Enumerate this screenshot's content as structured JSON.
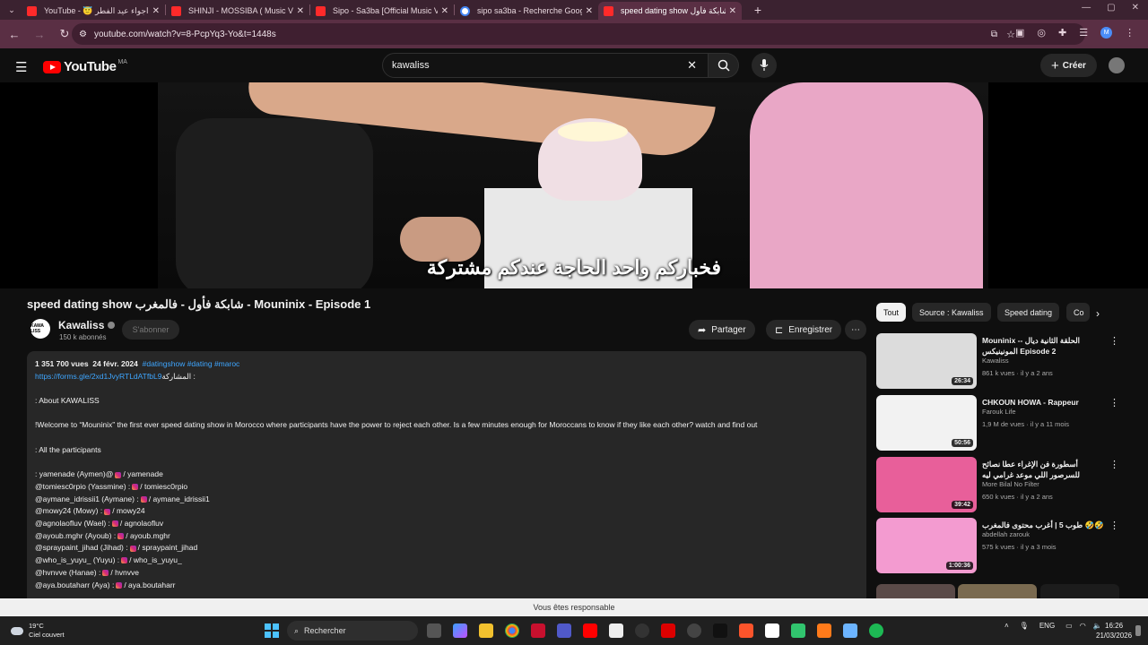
{
  "browser": {
    "tabs": [
      {
        "title": "YouTube - 😇 اجواء عيد الفطر",
        "icon": "youtube-icon",
        "active": false
      },
      {
        "title": "SHINJI - MOSSIBA ( Music Vid",
        "icon": "youtube-icon",
        "active": false
      },
      {
        "title": "Sipo - Sa3ba [Official Music Vi",
        "icon": "youtube-icon",
        "active": false
      },
      {
        "title": "sipo sa3ba - Recherche Google",
        "icon": "google-icon",
        "active": false
      },
      {
        "title": "speed dating show شابكة فأول",
        "icon": "youtube-icon",
        "active": true
      }
    ],
    "url": "youtube.com/watch?v=8-PcpYq3-Yo&t=1448s"
  },
  "youtube": {
    "logo_text": "YouTube",
    "country": "MA",
    "search_value": "kawaliss",
    "create_label": "Créer"
  },
  "video": {
    "subtitle": "فخباركم واحد الحاجة عندكم مشتركة",
    "title": "speed dating show شابكة فأول - فالمغرب - Mouninix - Episode 1",
    "channel": {
      "name": "Kawaliss",
      "subscribers": "150 k abonnés",
      "avatar_text": "KAWA LISS"
    },
    "subscribe_label": "S'abonner",
    "share_label": "Partager",
    "save_label": "Enregistrer"
  },
  "description": {
    "views": "1 351 700 vues",
    "date": "24 févr. 2024",
    "tags": "#datingshow #dating #maroc",
    "link": "https://forms.gle/2xd1JvyRTLdATfbL9",
    "link_suffix": "المشاركة :",
    "about": ": About KAWALISS",
    "welcome": "!Welcome to “Mouninix” the first ever speed dating show in Morocco where participants have the power to reject each other. Is a few minutes enough for Moroccans to know if they like each other? watch and find out",
    "participants_heading": ": All the participants",
    "participants": [
      {
        "left": " : yamenade (Aymen)@",
        "right": "/ yamenade"
      },
      {
        "left": "@tomiesc0rpio (Yassmine) :",
        "right": "/ tomiesc0rpio"
      },
      {
        "left": "@aymane_idrissii1 (Aymane) :",
        "right": "/ aymane_idrissii1"
      },
      {
        "left": "@mowy24 (Mowy) :",
        "right": "/ mowy24"
      },
      {
        "left": "@agnolaofluv (Wael) :",
        "right": "/ agnolaofluv"
      },
      {
        "left": "@ayoub.mghr (Ayoub) :",
        "right": "/ ayoub.mghr"
      },
      {
        "left": "@spraypaint_jihad (Jihad) :",
        "right": "/ spraypaint_jihad"
      },
      {
        "left": "@who_is_yuyu_ (Yuyu) :",
        "right": "/ who_is_yuyu_"
      },
      {
        "left": "@hvnvve (Hanae) :",
        "right": "/ hvnvve"
      },
      {
        "left": "@aya.boutaharr (Aya) :",
        "right": "/ aya.boutaharr"
      }
    ]
  },
  "chips": [
    "Tout",
    "Source : Kawaliss",
    "Speed dating",
    "Co"
  ],
  "recommendations": [
    {
      "title": "Mouninix -- الحلقة الثانية ديال المونينيكس Episode 2",
      "channel": "Kawaliss",
      "stats": "861 k vues · il y a 2 ans",
      "duration": "26:34",
      "thumb_color": "#dcdcdc"
    },
    {
      "title": "CHKOUN HOWA - Rappeur",
      "channel": "Farouk Life",
      "stats": "1,9 M de vues · il y a 11 mois",
      "duration": "50:56",
      "thumb_color": "#f2f2f2"
    },
    {
      "title": "أسطورة فن الإغراء عطا نصائح للسرصور اللي موعد غرامي ليه",
      "channel": "More Bilal No Filter",
      "stats": "650 k vues · il y a 2 ans",
      "duration": "39:42",
      "thumb_color": "#e85f9a"
    },
    {
      "title": "طوب 5 | أغرب محتوى فالمغرب 🤣🤣",
      "channel": "abdellah zarouk",
      "stats": "575 k vues · il y a 3 mois",
      "duration": "1:00:36",
      "thumb_color": "#f39bd0"
    }
  ],
  "notice": "Vous êtes responsable",
  "taskbar": {
    "weather_temp": "19°C",
    "weather_text": "Ciel couvert",
    "search_label": "Rechercher",
    "lang": "ENG",
    "time": "16:26",
    "date": "21/03/2026"
  }
}
